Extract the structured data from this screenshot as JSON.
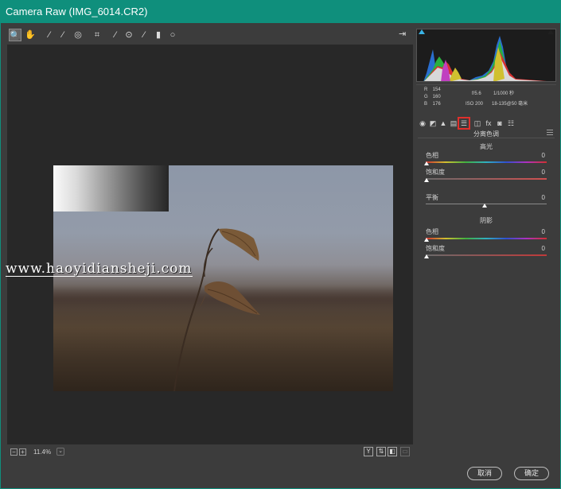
{
  "window": {
    "title": "Camera Raw (IMG_6014.CR2)"
  },
  "toolbar": {
    "tools": [
      {
        "name": "zoom-tool-icon",
        "glyph": "🔍"
      },
      {
        "name": "hand-tool-icon",
        "glyph": "✋"
      },
      {
        "name": "white-balance-tool-icon",
        "glyph": "⁄"
      },
      {
        "name": "color-sampler-tool-icon",
        "glyph": "⁄"
      },
      {
        "name": "targeted-adjustment-tool-icon",
        "glyph": "◎"
      },
      {
        "name": "crop-tool-icon",
        "glyph": "⌗"
      },
      {
        "name": "spot-removal-tool-icon",
        "glyph": "⁄"
      },
      {
        "name": "red-eye-tool-icon",
        "glyph": "⊙"
      },
      {
        "name": "adjustment-brush-icon",
        "glyph": "⁄"
      },
      {
        "name": "graduated-filter-icon",
        "glyph": "▮"
      },
      {
        "name": "radial-filter-icon",
        "glyph": "○"
      }
    ],
    "export_glyph": "⇥"
  },
  "watermark": {
    "text": "www.haoyidiansheji.com"
  },
  "statusbar": {
    "zoom_out_glyph": "−",
    "zoom_in_glyph": "+",
    "zoom": "11.4%",
    "zoom_menu_glyph": "⌄",
    "view_y_glyph": "Y",
    "view_before_after_glyph": "⇅",
    "view_settings_glyph": "◧",
    "view_toggle_glyph": "▭"
  },
  "buttons": {
    "cancel": "取消",
    "ok": "确定"
  },
  "info": {
    "r_label": "R",
    "r": "154",
    "g_label": "G",
    "g": "160",
    "b_label": "B",
    "b": "176",
    "aperture": "f/5.6",
    "shutter": "1/1000 秒",
    "iso": "ISO 200",
    "lens": "18-135@50 毫米"
  },
  "tabs": {
    "items": [
      {
        "name": "tab-basic-icon",
        "glyph": "◉"
      },
      {
        "name": "tab-tone-curve-icon",
        "glyph": "◩"
      },
      {
        "name": "tab-detail-icon",
        "glyph": "▲"
      },
      {
        "name": "tab-hsl-icon",
        "glyph": "▤"
      },
      {
        "name": "tab-split-toning-icon",
        "glyph": "☰"
      },
      {
        "name": "tab-lens-corrections-icon",
        "glyph": "◫"
      },
      {
        "name": "tab-effects-icon",
        "glyph": "fx"
      },
      {
        "name": "tab-camera-calibration-icon",
        "glyph": "◙"
      },
      {
        "name": "tab-presets-icon",
        "glyph": "☷"
      }
    ]
  },
  "split_toning": {
    "title": "分离色调",
    "highlights": {
      "title": "高光",
      "hue_label": "色相",
      "hue": "0",
      "saturation_label": "饱和度",
      "saturation": "0"
    },
    "balance": {
      "label": "平衡",
      "value": "0"
    },
    "shadows": {
      "title": "阴影",
      "hue_label": "色相",
      "hue": "0",
      "saturation_label": "饱和度",
      "saturation": "0"
    }
  },
  "colors": {
    "titlebar": "#0f8f7c",
    "selected_tab_outline": "#e0302c"
  }
}
